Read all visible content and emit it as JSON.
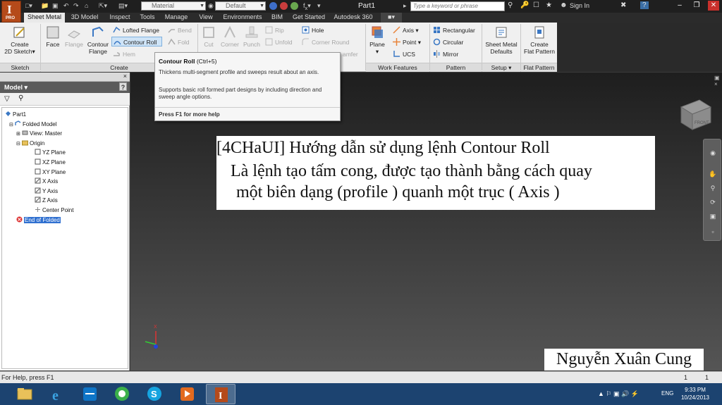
{
  "titlebar": {
    "material": "Material",
    "appearance": "Default",
    "document_title": "Part1",
    "search_placeholder": "Type a keyword or phrase",
    "sign_in": "Sign In",
    "help": "?"
  },
  "app_button": {
    "letter": "I",
    "badge": "PRO"
  },
  "tabs": [
    "Sheet Metal",
    "3D Model",
    "Inspect",
    "Tools",
    "Manage",
    "View",
    "Environments",
    "BIM",
    "Get Started",
    "Autodesk 360"
  ],
  "ribbon": {
    "sketch": {
      "create_line1": "Create",
      "create_line2": "2D Sketch",
      "label": "Sketch"
    },
    "create": {
      "face": "Face",
      "flange": "Flange",
      "contour_flange_1": "Contour",
      "contour_flange_2": "Flange",
      "lofted_flange": "Lofted Flange",
      "contour_roll": "Contour Roll",
      "hem": "Hem",
      "bend": "Bend",
      "fold": "Fold",
      "label": "Create"
    },
    "modify": {
      "cut": "Cut",
      "corner": "Corner",
      "punch": "Punch",
      "rip": "Rip",
      "unfold": "Unfold",
      "hole": "Hole",
      "corner_round": "Corner Round",
      "chamfer": "amfer"
    },
    "work_features": {
      "plane": "Plane",
      "axis": "Axis",
      "point": "Point",
      "ucs": "UCS",
      "label": "Work Features"
    },
    "pattern": {
      "rectangular": "Rectangular",
      "circular": "Circular",
      "mirror": "Mirror",
      "label": "Pattern"
    },
    "setup": {
      "defaults_1": "Sheet Metal",
      "defaults_2": "Defaults",
      "label": "Setup"
    },
    "flat_pattern": {
      "create_1": "Create",
      "create_2": "Flat Pattern",
      "label": "Flat Pattern"
    }
  },
  "tooltip": {
    "title": "Contour Roll",
    "shortcut": "(Ctrl+5)",
    "description": "Thickens multi-segment profile and sweeps result about an axis.",
    "support": "Supports basic roll formed part designs by including direction and sweep angle options.",
    "footer": "Press F1 for more help"
  },
  "browser": {
    "title": "Model",
    "tree": [
      {
        "label": "Part1",
        "depth": 0,
        "icon": "part-icon"
      },
      {
        "label": "Folded Model",
        "depth": 1,
        "icon": "folded-model-icon"
      },
      {
        "label": "View: Master",
        "depth": 2,
        "icon": "view-icon"
      },
      {
        "label": "Origin",
        "depth": 2,
        "icon": "folder-icon"
      },
      {
        "label": "YZ Plane",
        "depth": 3,
        "icon": "plane-icon"
      },
      {
        "label": "XZ Plane",
        "depth": 3,
        "icon": "plane-icon"
      },
      {
        "label": "XY Plane",
        "depth": 3,
        "icon": "plane-icon"
      },
      {
        "label": "X Axis",
        "depth": 3,
        "icon": "axis-icon"
      },
      {
        "label": "Y Axis",
        "depth": 3,
        "icon": "axis-icon"
      },
      {
        "label": "Z Axis",
        "depth": 3,
        "icon": "axis-icon"
      },
      {
        "label": "Center Point",
        "depth": 3,
        "icon": "center-point-icon"
      },
      {
        "label": "End of Folded",
        "depth": 2,
        "icon": "end-of-part-icon"
      }
    ]
  },
  "caption": {
    "line1": "[4CHaUI] Hướng dẫn sử dụng lệnh Contour Roll",
    "line2": "Là lệnh tạo tấm cong, được tạo thành bằng cách quay",
    "line3": "một biên dạng (profile ) quanh một trục ( Axis )"
  },
  "author": "Nguyễn Xuân Cung",
  "viewcube": {
    "face": "FRONT"
  },
  "triad": {
    "x": "X"
  },
  "status": {
    "help": "For Help, press F1",
    "count1": "1",
    "count2": "1"
  },
  "taskbar": {
    "time": "9:33 PM",
    "date": "10/24/2013",
    "lang": "ENG",
    "apps": [
      "file-explorer-icon",
      "internet-explorer-icon",
      "teamviewer-icon",
      "coccoc-icon",
      "skype-icon",
      "media-player-icon",
      "inventor-icon"
    ]
  },
  "colors": {
    "accent": "#3070d0",
    "taskbar": "#1c4370",
    "inventor": "#b54a1a"
  }
}
